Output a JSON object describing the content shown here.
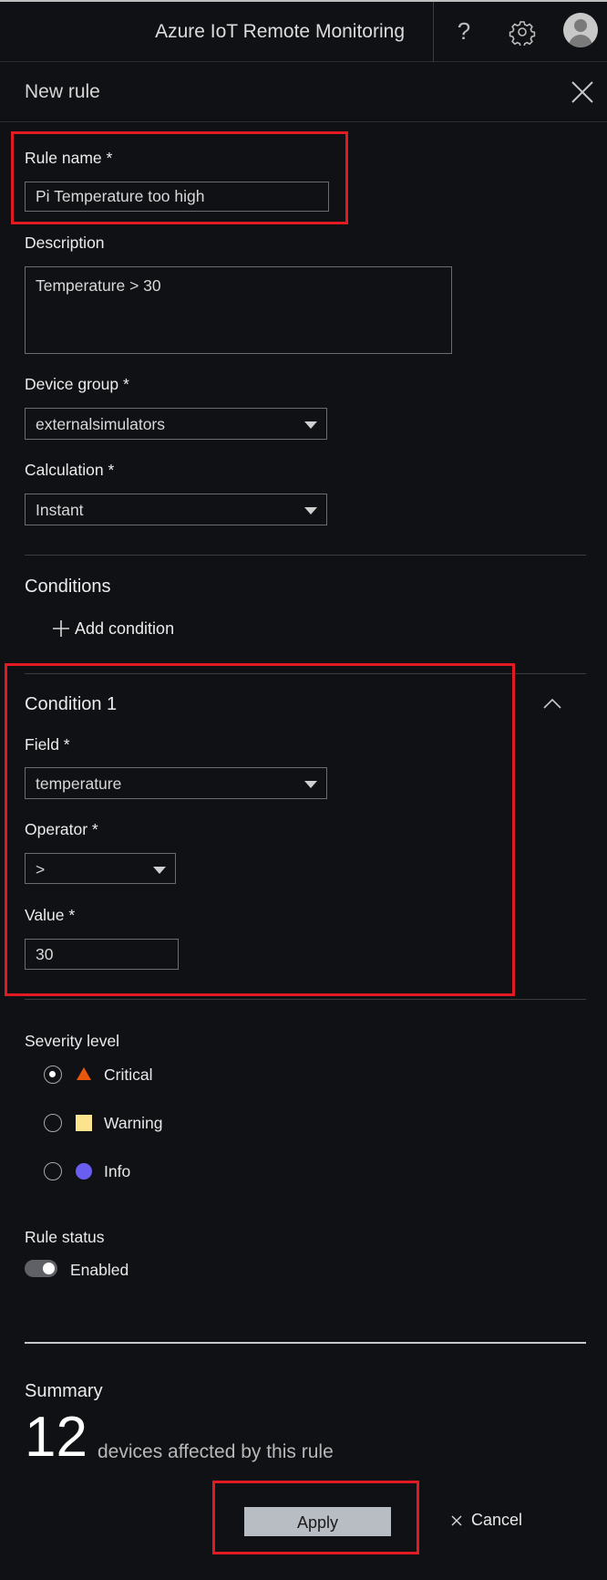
{
  "header": {
    "app_title": "Azure IoT Remote Monitoring",
    "help_icon": "?"
  },
  "panel": {
    "title": "New rule"
  },
  "form": {
    "rule_name": {
      "label": "Rule name *",
      "value": "Pi Temperature too high"
    },
    "description": {
      "label": "Description",
      "value": "Temperature > 30"
    },
    "device_group": {
      "label": "Device group *",
      "value": "externalsimulators"
    },
    "calculation": {
      "label": "Calculation *",
      "value": "Instant"
    }
  },
  "conditions": {
    "title": "Conditions",
    "add_label": "Add condition",
    "items": [
      {
        "title": "Condition 1",
        "field": {
          "label": "Field *",
          "value": "temperature"
        },
        "operator": {
          "label": "Operator *",
          "value": ">"
        },
        "value": {
          "label": "Value *",
          "value": "30"
        }
      }
    ]
  },
  "severity": {
    "label": "Severity level",
    "selected": "Critical",
    "options": [
      {
        "label": "Critical",
        "icon": "triangle-icon",
        "color": "#e8570c"
      },
      {
        "label": "Warning",
        "icon": "square-icon",
        "color": "#fce48e"
      },
      {
        "label": "Info",
        "icon": "circle-icon",
        "color": "#6a5ef0"
      }
    ]
  },
  "rule_status": {
    "label": "Rule status",
    "state": "Enabled"
  },
  "summary": {
    "title": "Summary",
    "count": "12",
    "text": "devices affected by this rule"
  },
  "actions": {
    "apply": "Apply",
    "cancel": "Cancel"
  },
  "colors": {
    "background": "#101114",
    "highlight": "#e21b23",
    "apply_button": "#b8bcc3"
  }
}
